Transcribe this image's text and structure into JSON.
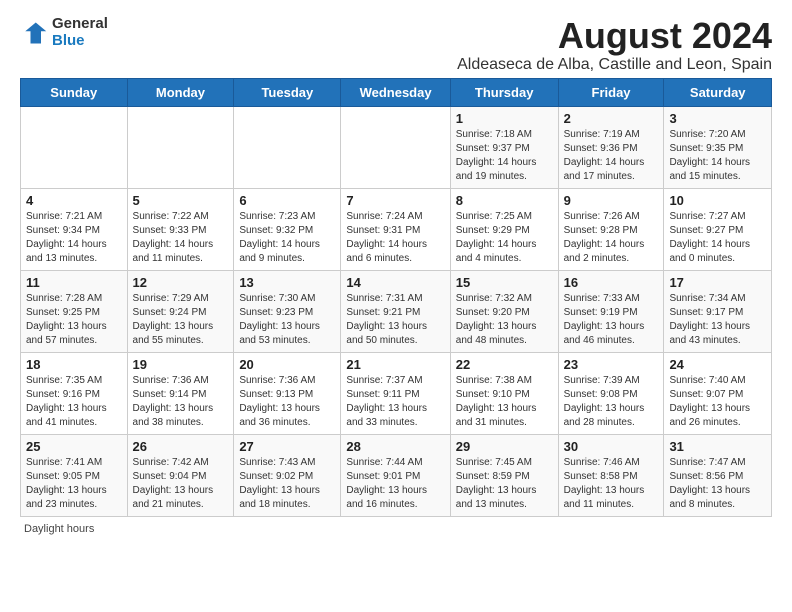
{
  "logo": {
    "line1": "General",
    "line2": "Blue"
  },
  "title": "August 2024",
  "subtitle": "Aldeaseca de Alba, Castille and Leon, Spain",
  "days_of_week": [
    "Sunday",
    "Monday",
    "Tuesday",
    "Wednesday",
    "Thursday",
    "Friday",
    "Saturday"
  ],
  "weeks": [
    [
      {
        "day": "",
        "detail": ""
      },
      {
        "day": "",
        "detail": ""
      },
      {
        "day": "",
        "detail": ""
      },
      {
        "day": "",
        "detail": ""
      },
      {
        "day": "1",
        "detail": "Sunrise: 7:18 AM\nSunset: 9:37 PM\nDaylight: 14 hours and 19 minutes."
      },
      {
        "day": "2",
        "detail": "Sunrise: 7:19 AM\nSunset: 9:36 PM\nDaylight: 14 hours and 17 minutes."
      },
      {
        "day": "3",
        "detail": "Sunrise: 7:20 AM\nSunset: 9:35 PM\nDaylight: 14 hours and 15 minutes."
      }
    ],
    [
      {
        "day": "4",
        "detail": "Sunrise: 7:21 AM\nSunset: 9:34 PM\nDaylight: 14 hours and 13 minutes."
      },
      {
        "day": "5",
        "detail": "Sunrise: 7:22 AM\nSunset: 9:33 PM\nDaylight: 14 hours and 11 minutes."
      },
      {
        "day": "6",
        "detail": "Sunrise: 7:23 AM\nSunset: 9:32 PM\nDaylight: 14 hours and 9 minutes."
      },
      {
        "day": "7",
        "detail": "Sunrise: 7:24 AM\nSunset: 9:31 PM\nDaylight: 14 hours and 6 minutes."
      },
      {
        "day": "8",
        "detail": "Sunrise: 7:25 AM\nSunset: 9:29 PM\nDaylight: 14 hours and 4 minutes."
      },
      {
        "day": "9",
        "detail": "Sunrise: 7:26 AM\nSunset: 9:28 PM\nDaylight: 14 hours and 2 minutes."
      },
      {
        "day": "10",
        "detail": "Sunrise: 7:27 AM\nSunset: 9:27 PM\nDaylight: 14 hours and 0 minutes."
      }
    ],
    [
      {
        "day": "11",
        "detail": "Sunrise: 7:28 AM\nSunset: 9:25 PM\nDaylight: 13 hours and 57 minutes."
      },
      {
        "day": "12",
        "detail": "Sunrise: 7:29 AM\nSunset: 9:24 PM\nDaylight: 13 hours and 55 minutes."
      },
      {
        "day": "13",
        "detail": "Sunrise: 7:30 AM\nSunset: 9:23 PM\nDaylight: 13 hours and 53 minutes."
      },
      {
        "day": "14",
        "detail": "Sunrise: 7:31 AM\nSunset: 9:21 PM\nDaylight: 13 hours and 50 minutes."
      },
      {
        "day": "15",
        "detail": "Sunrise: 7:32 AM\nSunset: 9:20 PM\nDaylight: 13 hours and 48 minutes."
      },
      {
        "day": "16",
        "detail": "Sunrise: 7:33 AM\nSunset: 9:19 PM\nDaylight: 13 hours and 46 minutes."
      },
      {
        "day": "17",
        "detail": "Sunrise: 7:34 AM\nSunset: 9:17 PM\nDaylight: 13 hours and 43 minutes."
      }
    ],
    [
      {
        "day": "18",
        "detail": "Sunrise: 7:35 AM\nSunset: 9:16 PM\nDaylight: 13 hours and 41 minutes."
      },
      {
        "day": "19",
        "detail": "Sunrise: 7:36 AM\nSunset: 9:14 PM\nDaylight: 13 hours and 38 minutes."
      },
      {
        "day": "20",
        "detail": "Sunrise: 7:36 AM\nSunset: 9:13 PM\nDaylight: 13 hours and 36 minutes."
      },
      {
        "day": "21",
        "detail": "Sunrise: 7:37 AM\nSunset: 9:11 PM\nDaylight: 13 hours and 33 minutes."
      },
      {
        "day": "22",
        "detail": "Sunrise: 7:38 AM\nSunset: 9:10 PM\nDaylight: 13 hours and 31 minutes."
      },
      {
        "day": "23",
        "detail": "Sunrise: 7:39 AM\nSunset: 9:08 PM\nDaylight: 13 hours and 28 minutes."
      },
      {
        "day": "24",
        "detail": "Sunrise: 7:40 AM\nSunset: 9:07 PM\nDaylight: 13 hours and 26 minutes."
      }
    ],
    [
      {
        "day": "25",
        "detail": "Sunrise: 7:41 AM\nSunset: 9:05 PM\nDaylight: 13 hours and 23 minutes."
      },
      {
        "day": "26",
        "detail": "Sunrise: 7:42 AM\nSunset: 9:04 PM\nDaylight: 13 hours and 21 minutes."
      },
      {
        "day": "27",
        "detail": "Sunrise: 7:43 AM\nSunset: 9:02 PM\nDaylight: 13 hours and 18 minutes."
      },
      {
        "day": "28",
        "detail": "Sunrise: 7:44 AM\nSunset: 9:01 PM\nDaylight: 13 hours and 16 minutes."
      },
      {
        "day": "29",
        "detail": "Sunrise: 7:45 AM\nSunset: 8:59 PM\nDaylight: 13 hours and 13 minutes."
      },
      {
        "day": "30",
        "detail": "Sunrise: 7:46 AM\nSunset: 8:58 PM\nDaylight: 13 hours and 11 minutes."
      },
      {
        "day": "31",
        "detail": "Sunrise: 7:47 AM\nSunset: 8:56 PM\nDaylight: 13 hours and 8 minutes."
      }
    ]
  ],
  "footer": "Daylight hours"
}
